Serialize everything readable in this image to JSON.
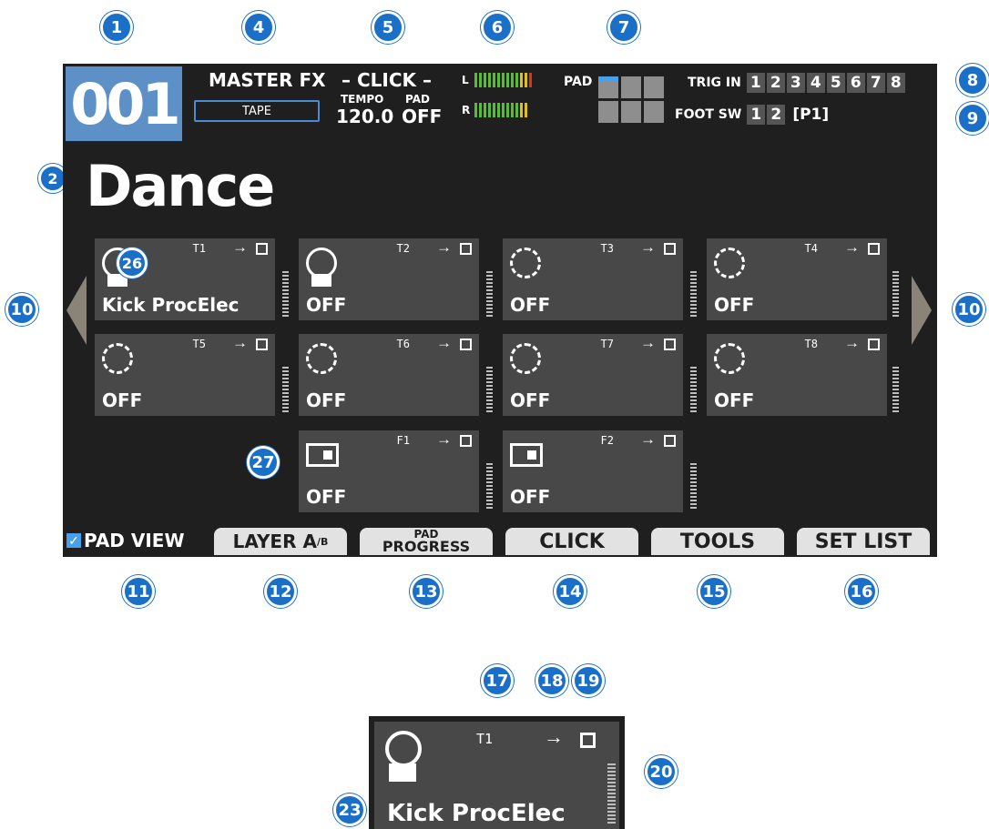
{
  "callouts": [
    "1",
    "2",
    "4",
    "5",
    "6",
    "7",
    "8",
    "9",
    "10",
    "10",
    "11",
    "12",
    "13",
    "14",
    "15",
    "16",
    "17",
    "18",
    "19",
    "20",
    "23",
    "26",
    "27"
  ],
  "header": {
    "patch_number": "001",
    "patch_name": "Dance",
    "master_fx_label": "MASTER FX",
    "master_fx_value": "TAPE",
    "click_label": "– CLICK –",
    "tempo_label": "TEMPO",
    "pad_label_small": "PAD",
    "tempo_value": "120.0",
    "pad_value": "OFF",
    "meter_l": "L",
    "meter_r": "R",
    "pad_indicator_label": "PAD",
    "trig_in_label": "TRIG IN",
    "trig_in_numbers": [
      "1",
      "2",
      "3",
      "4",
      "5",
      "6",
      "7",
      "8"
    ],
    "foot_sw_label": "FOOT SW",
    "foot_sw_numbers": [
      "1",
      "2"
    ],
    "foot_sw_page": "[P1]"
  },
  "tracks": [
    {
      "name": "T1",
      "value": "Kick ProcElec",
      "icon": "pedal"
    },
    {
      "name": "T2",
      "value": "OFF",
      "icon": "pedal"
    },
    {
      "name": "T3",
      "value": "OFF",
      "icon": "pad"
    },
    {
      "name": "T4",
      "value": "OFF",
      "icon": "pad"
    },
    {
      "name": "T5",
      "value": "OFF",
      "icon": "pad"
    },
    {
      "name": "T6",
      "value": "OFF",
      "icon": "pad"
    },
    {
      "name": "T7",
      "value": "OFF",
      "icon": "pad"
    },
    {
      "name": "T8",
      "value": "OFF",
      "icon": "pad"
    },
    {
      "name": "F1",
      "value": "OFF",
      "icon": "fx"
    },
    {
      "name": "F2",
      "value": "OFF",
      "icon": "fx"
    }
  ],
  "function_bar": {
    "pad_view_label": "PAD VIEW",
    "pad_view_checked": true,
    "layer_label": "LAYER A",
    "layer_sup": "/B",
    "pad_progress_top": "PAD",
    "pad_progress_bottom": "PROGRESS",
    "click_button": "CLICK",
    "tools_button": "TOOLS",
    "set_list_button": "SET LIST"
  },
  "detail": {
    "name": "T1",
    "value": "Kick ProcElec"
  },
  "colors": {
    "accent": "#1b6fc7",
    "screen_bg": "#1f1f1f",
    "cell_bg": "#484848",
    "patch_bg": "#5c90c6",
    "meter_green": "#5aba3a",
    "meter_yellow": "#e0c020",
    "meter_red": "#e03020"
  }
}
